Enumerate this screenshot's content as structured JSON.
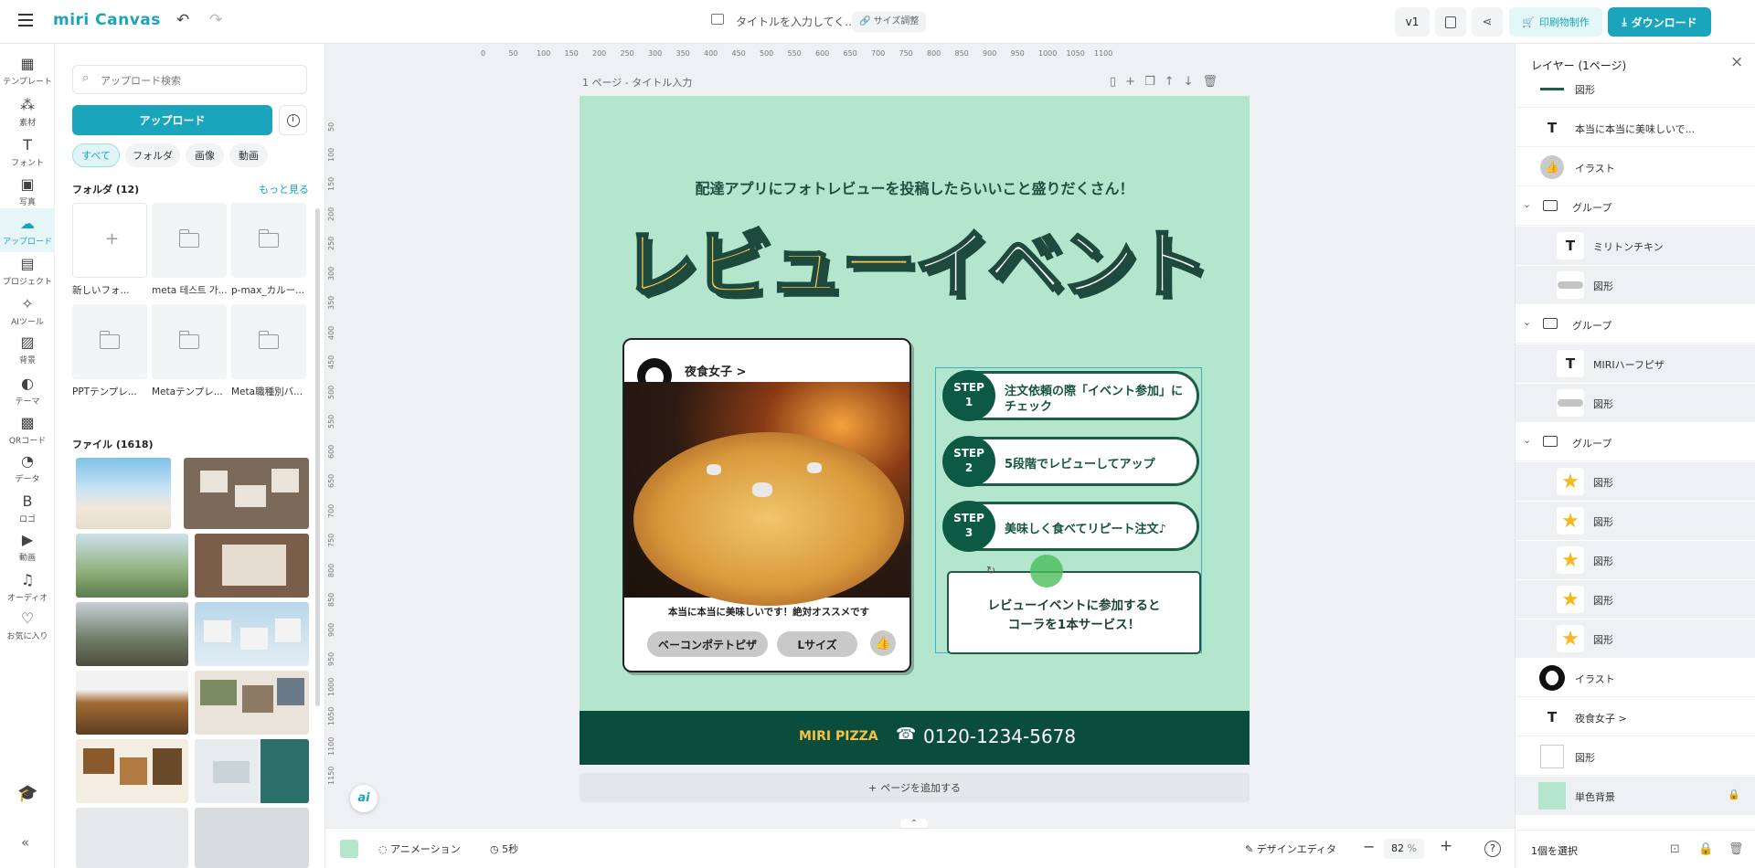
{
  "app": {
    "logo": "miri Canvas"
  },
  "topbar": {
    "doc_title": "タイトルを入力してく...",
    "resize_label": "サイズ調整",
    "version": "v1",
    "print_label": "印刷物制作",
    "download_label": "ダウンロード"
  },
  "rail": [
    {
      "label": "テンプレート",
      "icon": "template-icon"
    },
    {
      "label": "素材",
      "icon": "elements-icon"
    },
    {
      "label": "フォント",
      "icon": "font-icon"
    },
    {
      "label": "写真",
      "icon": "photo-icon"
    },
    {
      "label": "アップロード",
      "icon": "upload-icon"
    },
    {
      "label": "プロジェクト",
      "icon": "project-icon"
    },
    {
      "label": "AIツール",
      "icon": "ai-tool-icon"
    },
    {
      "label": "背景",
      "icon": "background-icon"
    },
    {
      "label": "テーマ",
      "icon": "theme-icon"
    },
    {
      "label": "QRコード",
      "icon": "qr-icon"
    },
    {
      "label": "データ",
      "icon": "data-icon"
    },
    {
      "label": "ロゴ",
      "icon": "logo-icon"
    },
    {
      "label": "動画",
      "icon": "video-icon"
    },
    {
      "label": "オーディオ",
      "icon": "audio-icon"
    },
    {
      "label": "お気に入り",
      "icon": "heart-icon"
    }
  ],
  "panel": {
    "search_placeholder": "アップロード検索",
    "upload_button": "アップロード",
    "filters": [
      "すべて",
      "フォルダ",
      "画像",
      "動画"
    ],
    "folders_title": "フォルダ (12)",
    "more_label": "もっと見る",
    "folders": [
      "新しいフォ...",
      "meta 테스트 가...",
      "p-max_カルー...",
      "PPTテンプレ...",
      "Metaテンプレ...",
      "Meta職種別バ..."
    ],
    "files_title": "ファイル (1618)"
  },
  "canvas": {
    "page_label": "1 ページ - タイトル入力",
    "ruler": [
      "0",
      "50",
      "100",
      "150",
      "200",
      "250",
      "300",
      "350",
      "400",
      "450",
      "500",
      "550",
      "600",
      "650",
      "700",
      "750",
      "800",
      "850",
      "900",
      "950",
      "1000",
      "1050",
      "1100"
    ],
    "ruler_v": [
      "50",
      "100",
      "150",
      "200",
      "250",
      "300",
      "350",
      "400",
      "450",
      "500",
      "550",
      "600",
      "650",
      "700",
      "750",
      "800",
      "850",
      "900",
      "950",
      "1000",
      "1050",
      "1100",
      "1150"
    ],
    "subtitle": "配達アプリにフォトレビューを投稿したらいいこと盛りだくさん！",
    "headline_a": "レビュー",
    "headline_b": "イベント",
    "card_user": "夜食女子 >",
    "card_review": "本当に本当に美味しいです！絶対オススメです",
    "card_tag1": "ベーコンポテトピザ",
    "card_tag2": "Lサイズ",
    "steps": [
      {
        "badge1": "STEP",
        "badge2": "1",
        "text1": "注文依頼の際「イベント参加」に",
        "text2": "チェック"
      },
      {
        "badge1": "STEP",
        "badge2": "2",
        "text1": "5段階でレビューしてアップ",
        "text2": ""
      },
      {
        "badge1": "STEP",
        "badge2": "3",
        "text1": "美味しく食べてリピート注文♪",
        "text2": ""
      }
    ],
    "promo_line1": "レビューイベントに参加すると",
    "promo_line2": "コーラを1本サービス！",
    "brand": "MIRI PIZZA",
    "phone": "0120-1234-5678",
    "add_page": "ページを追加する"
  },
  "bottombar": {
    "animation": "アニメーション",
    "duration": "5秒",
    "design_editor": "デザインエディタ",
    "zoom": "82",
    "zoom_unit": "%"
  },
  "layers": {
    "title": "レイヤー (1ページ)",
    "items": [
      {
        "name": "図形",
        "kind": "line"
      },
      {
        "name": "本当に本当に美味しいで...",
        "kind": "text"
      },
      {
        "name": "イラスト",
        "kind": "like"
      },
      {
        "name": "グループ",
        "kind": "group"
      },
      {
        "name": "ミリトンチキン",
        "kind": "text"
      },
      {
        "name": "図形",
        "kind": "grey"
      },
      {
        "name": "グループ",
        "kind": "group"
      },
      {
        "name": "MIRIハーフピザ",
        "kind": "text"
      },
      {
        "name": "図形",
        "kind": "grey"
      },
      {
        "name": "グループ",
        "kind": "group"
      },
      {
        "name": "図形",
        "kind": "star"
      },
      {
        "name": "図形",
        "kind": "star"
      },
      {
        "name": "図形",
        "kind": "star"
      },
      {
        "name": "図形",
        "kind": "star"
      },
      {
        "name": "図形",
        "kind": "star"
      },
      {
        "name": "イラスト",
        "kind": "avatar"
      },
      {
        "name": "夜食女子 >",
        "kind": "text"
      },
      {
        "name": "図形",
        "kind": "white"
      },
      {
        "name": "単色背景",
        "kind": "bg"
      }
    ],
    "footer": "1個を選択"
  },
  "colors": {
    "accent": "#1aa5bc",
    "poster_bg": "#b3e6cc",
    "footer_bg": "#0a4d3c",
    "headline_yellow": "#f6c54a",
    "brand_yellow": "#f5c243"
  }
}
